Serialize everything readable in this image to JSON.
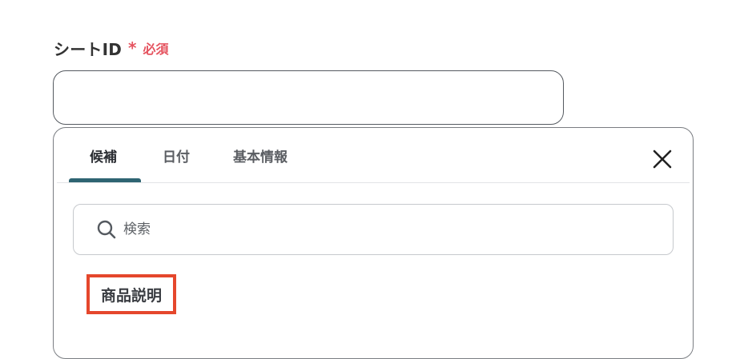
{
  "field": {
    "label": "シートID",
    "asterisk": "*",
    "required_text": "必須",
    "value": ""
  },
  "tabs": [
    {
      "label": "候補",
      "active": true
    },
    {
      "label": "日付",
      "active": false
    },
    {
      "label": "基本情報",
      "active": false
    }
  ],
  "close_icon": "close-icon",
  "search": {
    "icon": "search-icon",
    "placeholder": "検索",
    "value": ""
  },
  "candidates": [
    {
      "label": "商品説明",
      "highlighted": true
    }
  ],
  "colors": {
    "required": "#e5535f",
    "tab_indicator": "#2e6472",
    "highlight_border": "#e5472c"
  }
}
